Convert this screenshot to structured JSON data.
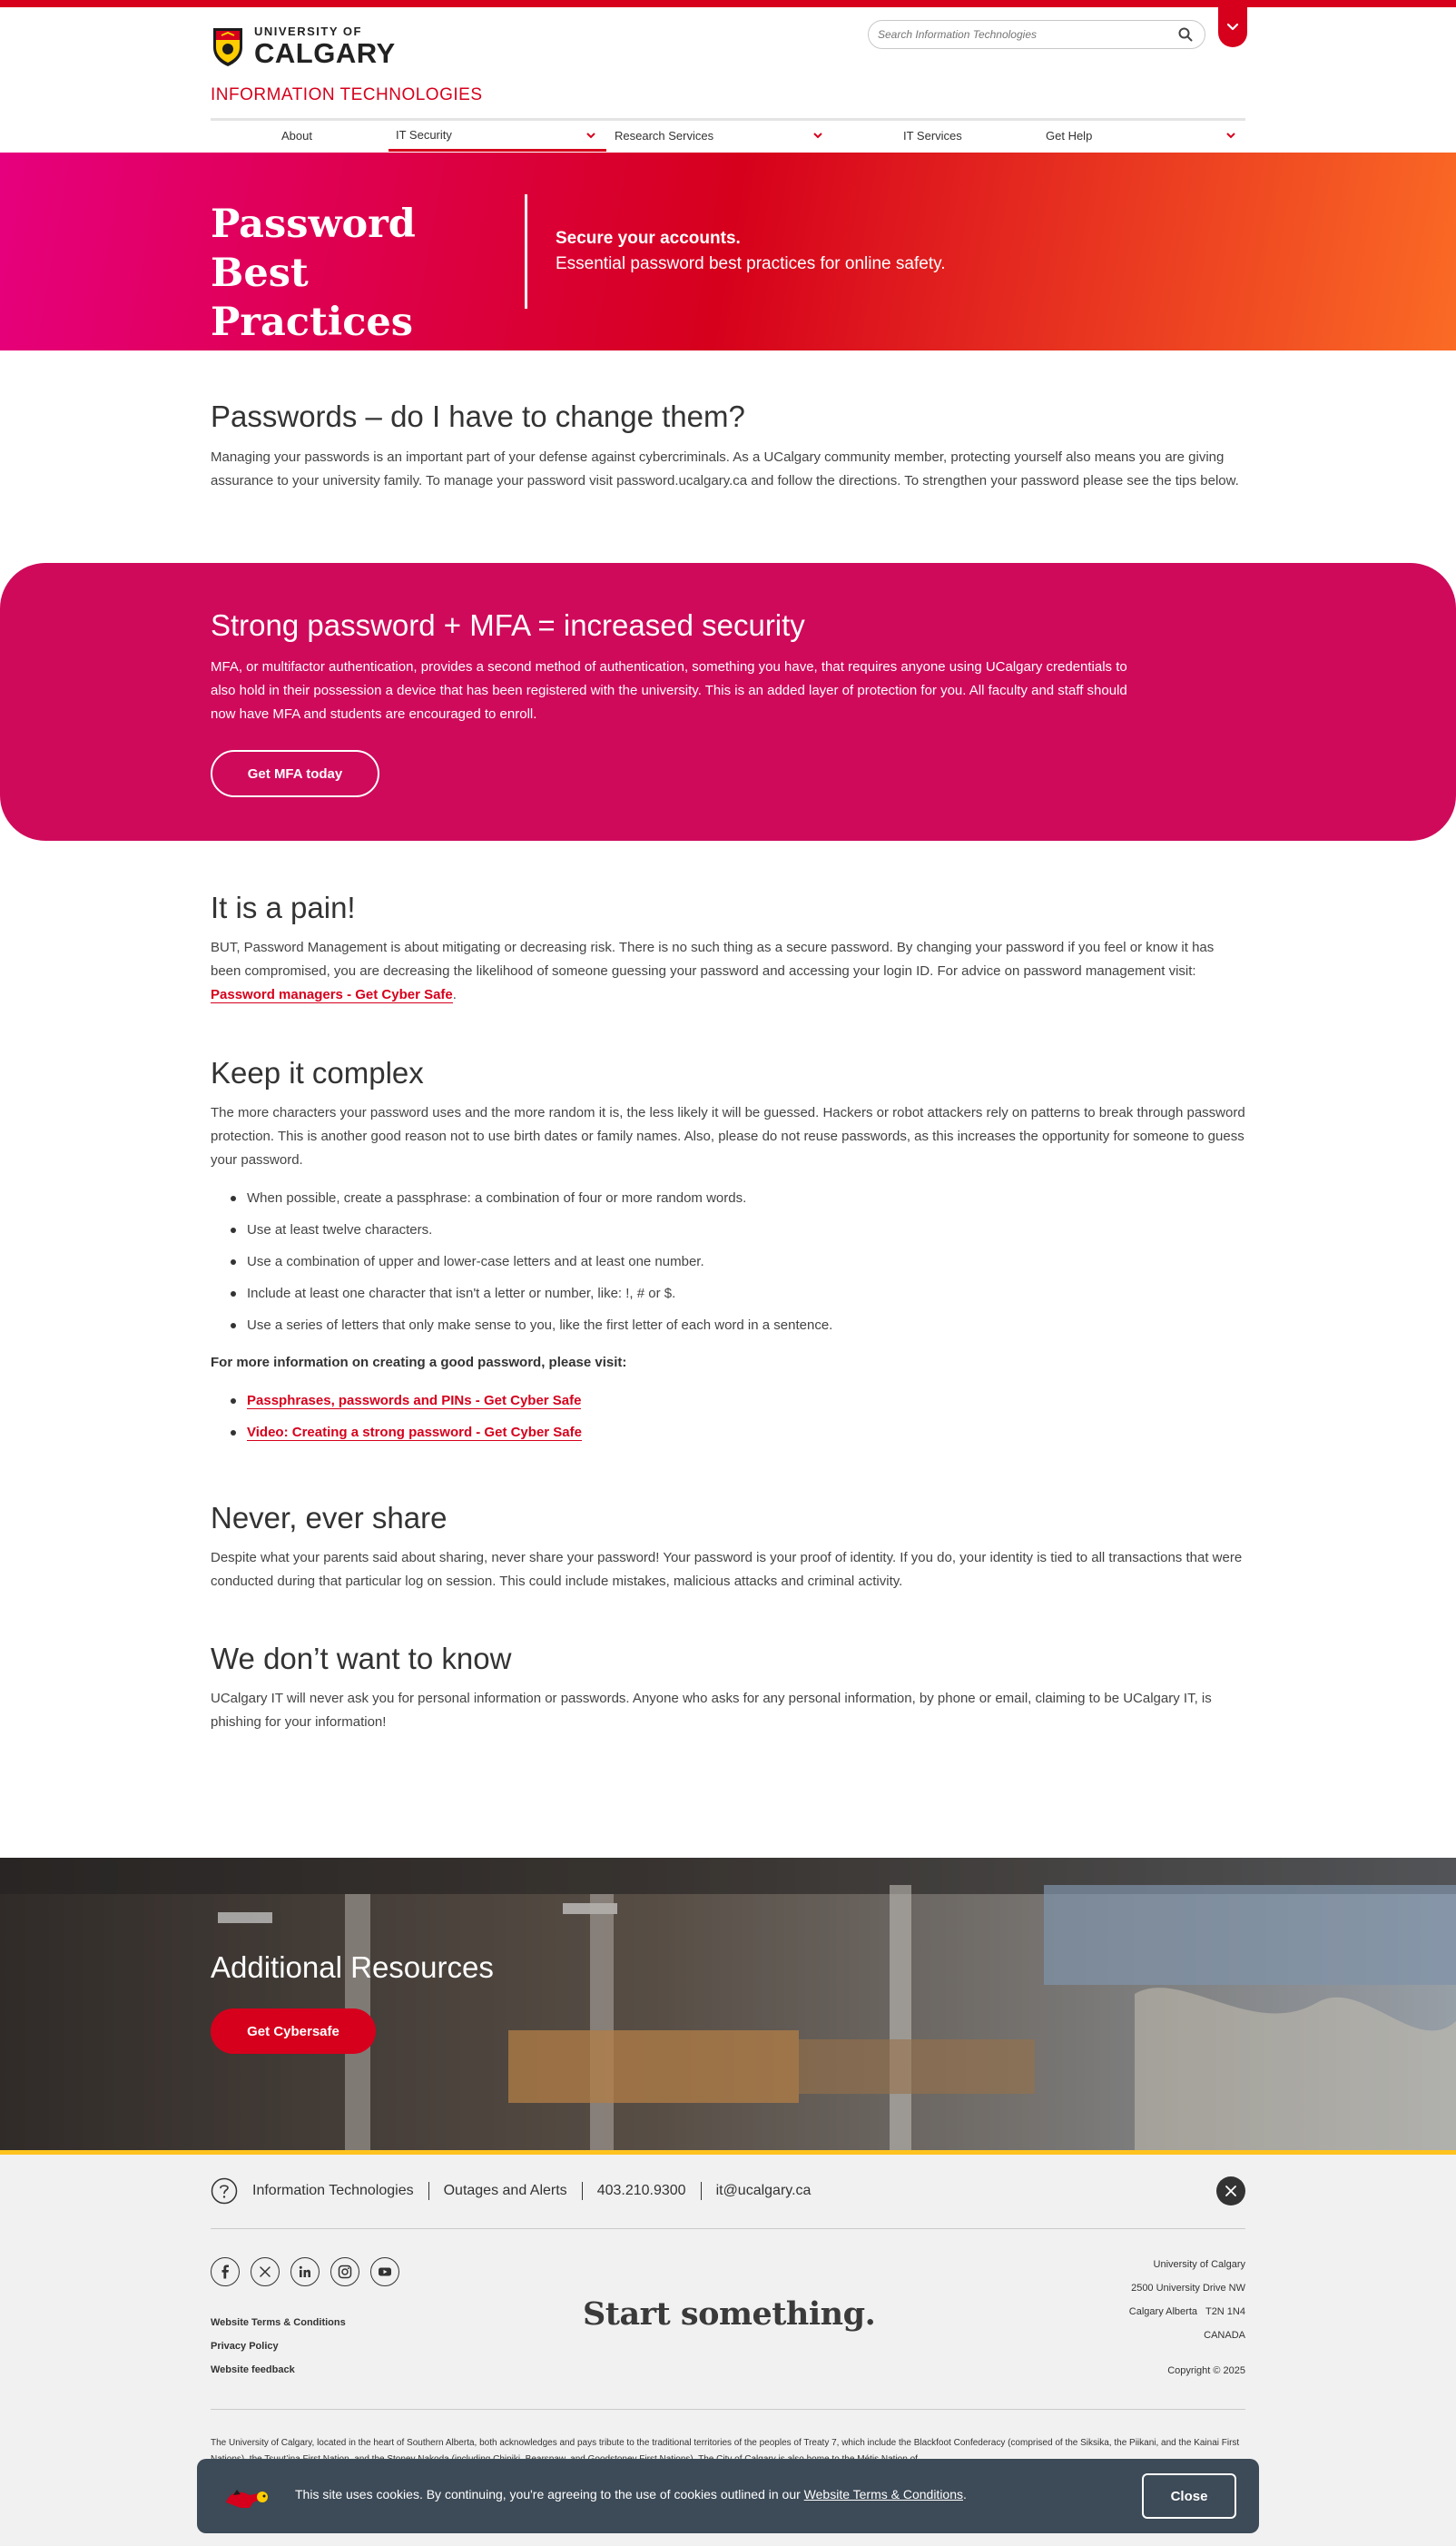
{
  "header": {
    "logo_small": "UNIVERSITY OF",
    "logo_big": "CALGARY",
    "search_placeholder": "Search Information Technologies",
    "department": "INFORMATION TECHNOLOGIES",
    "accent_color": "#d6001c"
  },
  "nav": {
    "items": [
      {
        "label": "About",
        "has_dropdown": false
      },
      {
        "label": "IT Security",
        "has_dropdown": true,
        "active": true
      },
      {
        "label": "Research Services",
        "has_dropdown": true
      },
      {
        "label": "IT Services",
        "has_dropdown": false
      },
      {
        "label": "Get Help",
        "has_dropdown": true
      }
    ]
  },
  "hero": {
    "title_line1": "Password",
    "title_line2": "Best Practices",
    "subtitle_bold": "Secure your accounts.",
    "subtitle": "Essential password best practices for online safety."
  },
  "intro": {
    "heading": "Passwords – do I have to change them?",
    "body": "Managing your passwords is an important part of your defense against cybercriminals. As a UCalgary community member, protecting yourself also means you are giving assurance to your university family. To manage your password visit password.ucalgary.ca and follow the directions. To strengthen your password please see the tips below."
  },
  "mfa": {
    "heading": "Strong password + MFA = increased security",
    "body": "MFA, or multifactor authentication, provides a second method of authentication, something you have, that requires anyone using UCalgary credentials to also hold in their possession a device that has been registered with the university. This is an added layer of protection for you. All faculty and staff should now have MFA and students are encouraged to enroll.",
    "button": "Get MFA today",
    "color": "#cf0a5b"
  },
  "pain": {
    "heading": "It is a pain!",
    "body": "BUT, Password Management is about mitigating or decreasing risk. There is no such thing as a secure password. By changing your password if you feel or know it has been compromised, you are decreasing the likelihood of someone guessing your password and accessing your login ID. For advice on password management visit: ",
    "link": "Password managers - Get Cyber Safe",
    "tail": "."
  },
  "complex": {
    "heading": "Keep it complex",
    "body": "The more characters your password uses and the more random it is, the less likely it will be guessed. Hackers or robot attackers rely on patterns to break through password protection. This is another good reason not to use birth dates or family names. Also, please do not reuse passwords, as this increases the opportunity for someone to guess your password.",
    "tips": [
      "When possible, create a passphrase: a combination of four or more random words.",
      "Use at least twelve characters.",
      "Use a combination of upper and lower-case letters and at least one number.",
      "Include at least one character that isn't a letter or number, like: !, # or $.",
      "Use a series of letters that only make sense to you, like the first letter of each word in a sentence."
    ],
    "more_label": "For more information on creating a good password, please visit:",
    "links": [
      "Passphrases, passwords and PINs - Get Cyber Safe",
      "Video: Creating a strong password - Get Cyber Safe"
    ]
  },
  "share": {
    "heading": "Never, ever share",
    "body": "Despite what your parents said about sharing, never share your password! Your password is your proof of identity. If you do, your identity is tied to all transactions that were conducted during that particular log on session. This could include mistakes, malicious attacks and criminal activity."
  },
  "know": {
    "heading": "We don’t want to know",
    "body": "UCalgary IT will never ask you for personal information or passwords. Anyone who asks for any personal information, by phone or email, claiming to be UCalgary IT, is phishing for your information!"
  },
  "resources": {
    "heading": "Additional Resources",
    "button": "Get Cybersafe"
  },
  "footer": {
    "contact_name": "Information Technologies",
    "outages": "Outages and Alerts",
    "phone": "403.210.9300",
    "email": "it@ucalgary.ca",
    "links": [
      "Website Terms & Conditions",
      "Privacy Policy",
      "Website feedback"
    ],
    "tagline": "Start something.",
    "address": [
      "University of Calgary",
      "2500 University Drive NW",
      "Calgary Alberta   T2N 1N4",
      "CANADA"
    ],
    "copyright": "Copyright © 2025",
    "land_ack": "The University of Calgary, located in the heart of Southern Alberta, both acknowledges and pays tribute to the traditional territories of the peoples of Treaty 7, which include the Blackfoot Confederacy (comprised of the Siksika, the Piikani, and the Kainai First Nations), the Tsuut’ina First Nation, and the Stoney Nakoda (including Chiniki, Bearspaw, and Goodstoney First Nations). The City of Calgary is also home to the Métis Nation of"
  },
  "cookie": {
    "text": "This site uses cookies. By continuing, you're agreeing to the use of cookies outlined in our ",
    "link": "Website Terms & Conditions",
    "tail": ".",
    "button": "Close"
  }
}
